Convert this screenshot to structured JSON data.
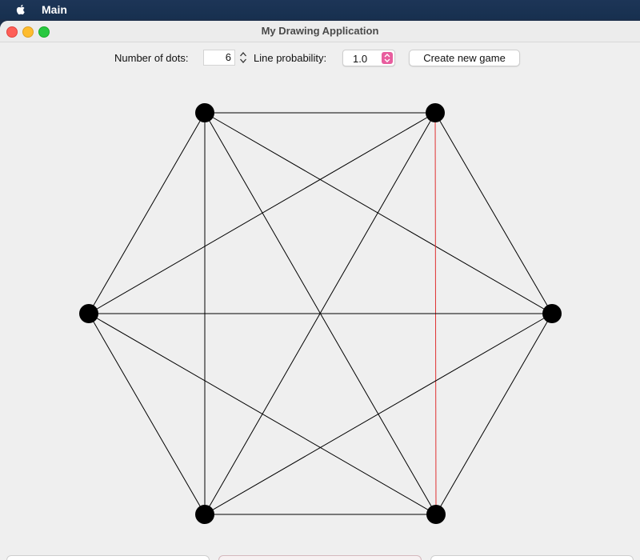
{
  "menubar": {
    "app_name": "Main"
  },
  "window": {
    "title": "My Drawing Application"
  },
  "toolbar": {
    "dots_label": "Number of dots:",
    "dots_value": "6",
    "probability_label": "Line probability:",
    "probability_value": "1.0",
    "create_button_label": "Create new game"
  },
  "graph": {
    "dot_count": 6,
    "edges_all_connected": true,
    "highlighted_edge": [
      "top-right",
      "bottom-right"
    ],
    "colors": {
      "dot": "#000000",
      "line": "#000000",
      "highlight": "#e03030"
    }
  }
}
